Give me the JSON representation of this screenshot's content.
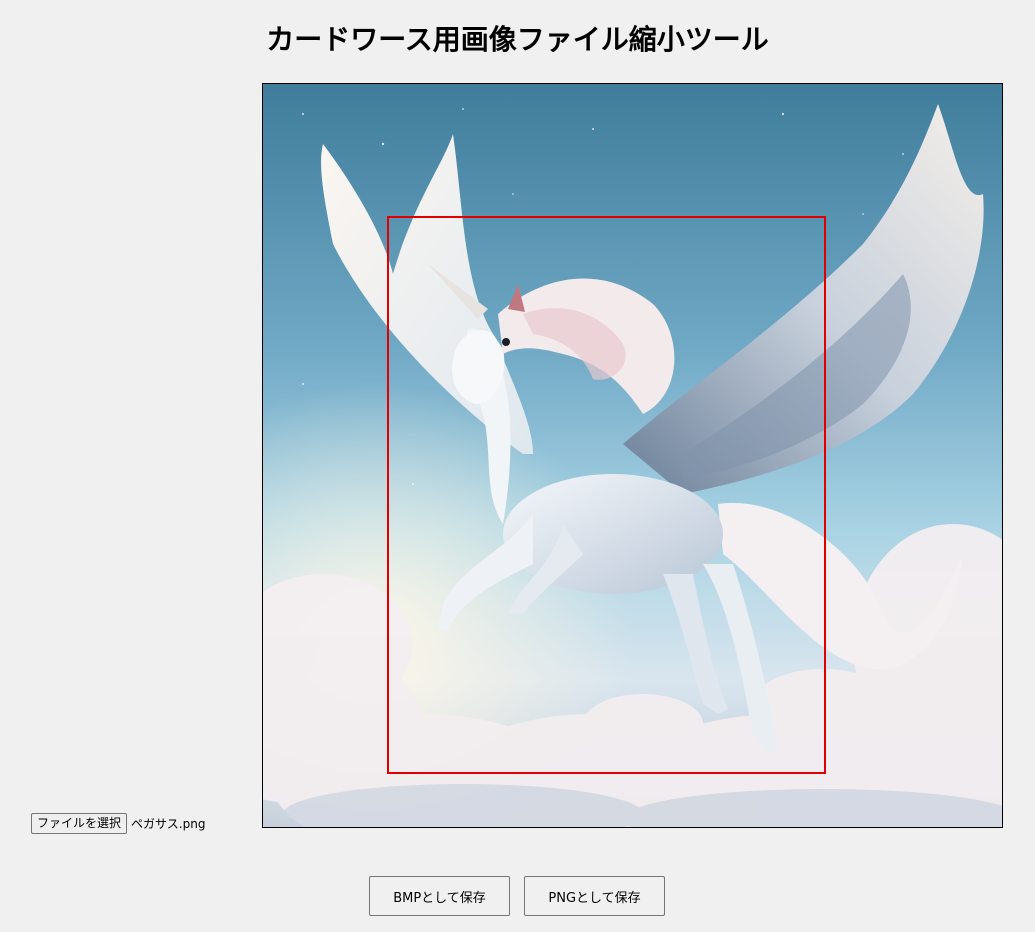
{
  "page": {
    "title": "カードワース用画像ファイル縮小ツール"
  },
  "file_input": {
    "button_label": "ファイルを選択",
    "file_name": "ペガサス.png"
  },
  "preview": {
    "subject": "white winged pegasus with unicorn horn flying among clouds",
    "selection_color": "#e00000"
  },
  "actions": {
    "save_bmp_label": "BMPとして保存",
    "save_png_label": "PNGとして保存"
  }
}
